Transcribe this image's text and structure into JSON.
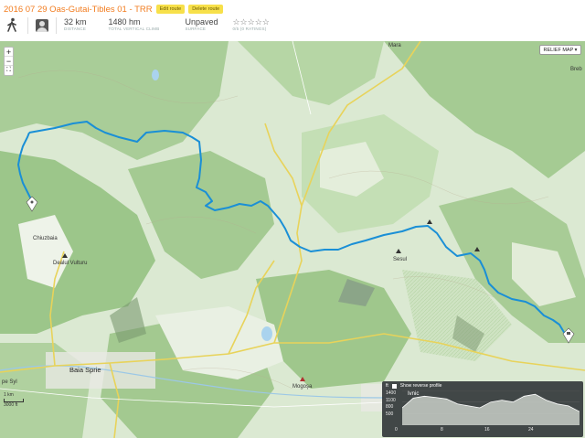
{
  "route": {
    "title": "2016 07 29 Oas-Gutai-Tibles 01 - TRR",
    "edit_label": "Edit route",
    "delete_label": "Delete route"
  },
  "stats": {
    "activity_icon": "walking-icon",
    "distance": "32 km",
    "distance_label": "DISTANCE",
    "climb": "1480 hm",
    "climb_label": "TOTAL VERTICAL CLIMB",
    "surface": "Unpaved",
    "surface_label": "SURFACE",
    "rating_stars": "☆☆☆☆☆",
    "rating_label": "0/5 (0 RATINGS)"
  },
  "map": {
    "relief_button": "RELIEF MAP ▾",
    "zoom_in": "+",
    "zoom_out": "−",
    "fullscreen": "⛶",
    "scale_top": "1 km",
    "scale_bottom": "3000 ft",
    "labels": {
      "maria": "Mara",
      "breb": "Breb",
      "chiuzbaia": "Chiuzbaia",
      "baia_sprie": "Baia Sprie",
      "sisesti_peak": "Dealul Vulturu",
      "gutai_peak": "Gutâi",
      "mogosa_peak": "Mogoşa",
      "sesul": "Sesul",
      "syl": "pe Syl"
    },
    "route_color": "#1a8fd6",
    "road_color": "#e8d35a"
  },
  "elevation": {
    "unit_toggle": "ft",
    "reverse_label": "Show reverse profile",
    "place_label": "Ivnic",
    "y_ticks": [
      "1400",
      "1100",
      "800",
      "500"
    ],
    "x_ticks": [
      "0",
      "8",
      "16",
      "24"
    ],
    "chart_data": {
      "type": "area",
      "x": [
        0,
        2,
        4,
        6,
        8,
        10,
        12,
        14,
        16,
        18,
        20,
        22,
        24,
        26,
        28,
        30,
        32
      ],
      "values": [
        950,
        1200,
        1250,
        1220,
        1180,
        1050,
        1000,
        950,
        1100,
        1150,
        1100,
        1250,
        1300,
        1150,
        1050,
        1000,
        850
      ],
      "ylim": [
        500,
        1400
      ],
      "xlim": [
        0,
        32
      ]
    }
  }
}
